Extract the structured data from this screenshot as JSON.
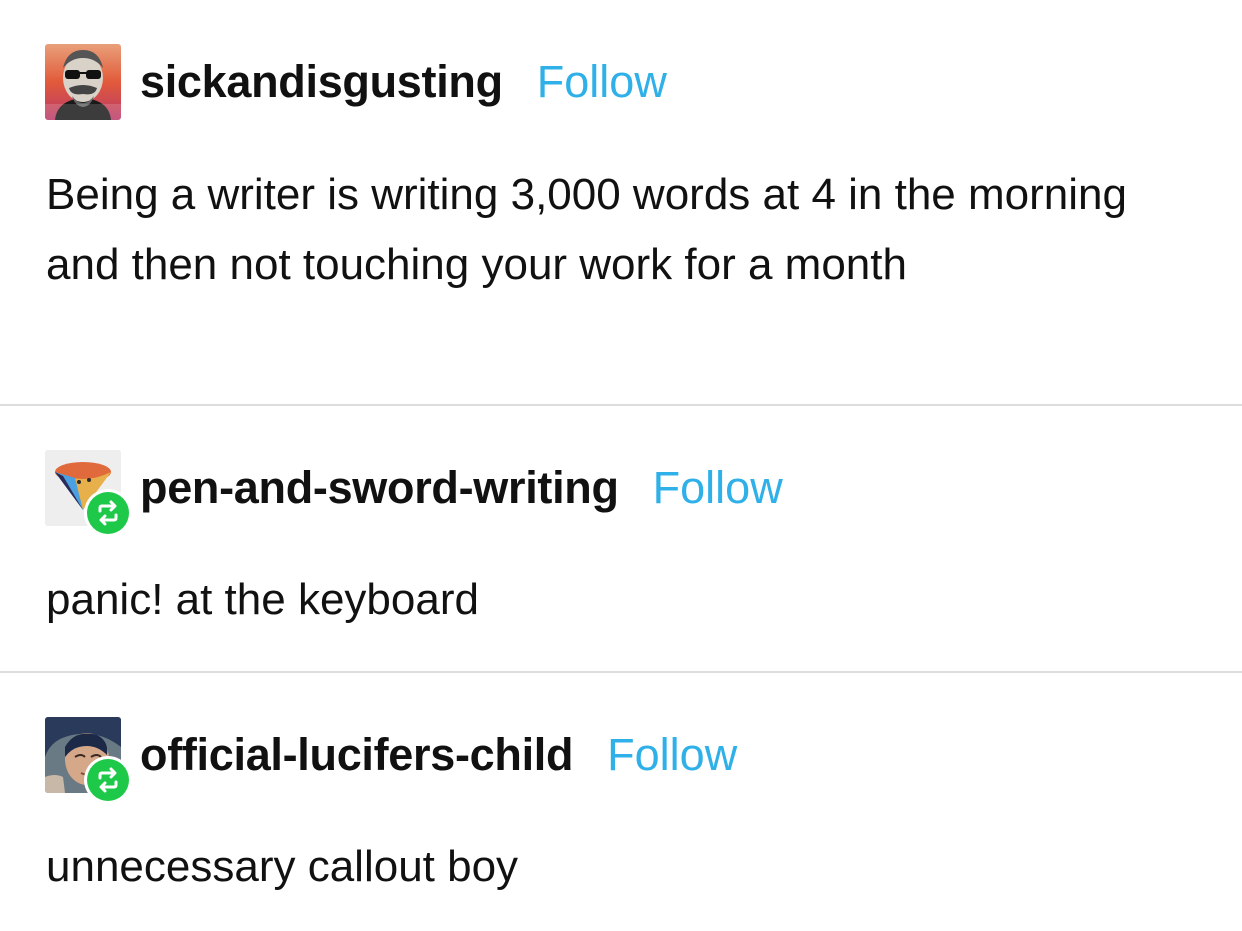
{
  "posts": [
    {
      "username": "sickandisgusting",
      "follow_label": "Follow",
      "avatar_icon": "sunglasses-man-avatar",
      "is_reblog": false,
      "body": "Being a writer is writing 3,000 words at 4 in the morning and then not touching your work for a month"
    },
    {
      "username": "pen-and-sword-writing",
      "follow_label": "Follow",
      "avatar_icon": "cone-avatar",
      "is_reblog": true,
      "reblog_icon": "reblog-icon",
      "body": "panic! at the keyboard"
    },
    {
      "username": "official-lucifers-child",
      "follow_label": "Follow",
      "avatar_icon": "person-photo-avatar",
      "is_reblog": true,
      "reblog_icon": "reblog-icon",
      "body": "unnecessary callout boy"
    }
  ],
  "colors": {
    "follow": "#2fb0e8",
    "reblog_badge": "#1ec94a",
    "divider": "#dddddd",
    "text": "#111111"
  }
}
